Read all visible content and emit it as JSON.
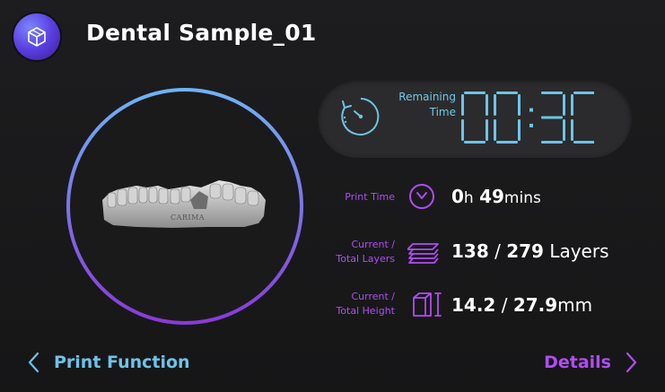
{
  "header": {
    "title": "Dental Sample_01",
    "app_icon": "cube-icon"
  },
  "preview": {
    "model_text": "CARIMA"
  },
  "remaining": {
    "label_line1": "Remaining",
    "label_line2": "Time",
    "value": "00:30",
    "icon": "timer-icon"
  },
  "stats": {
    "print_time": {
      "label": "Print Time",
      "hours": "0",
      "hours_unit": "h",
      "minutes": "49",
      "minutes_unit": "mins",
      "icon": "clock-icon"
    },
    "layers": {
      "label_line1": "Current /",
      "label_line2": "Total Layers",
      "current": "138",
      "total": "279",
      "unit": "Layers",
      "icon": "layers-icon"
    },
    "height": {
      "label_line1": "Current /",
      "label_line2": "Total Height",
      "current": "14.2",
      "total": "27.9",
      "unit": "mm",
      "icon": "height-icon"
    }
  },
  "footer": {
    "back_label": "Print Function",
    "details_label": "Details"
  },
  "colors": {
    "accent_blue": "#6ec3e8",
    "accent_purple": "#b14cf2",
    "background": "#1b1b1c"
  }
}
